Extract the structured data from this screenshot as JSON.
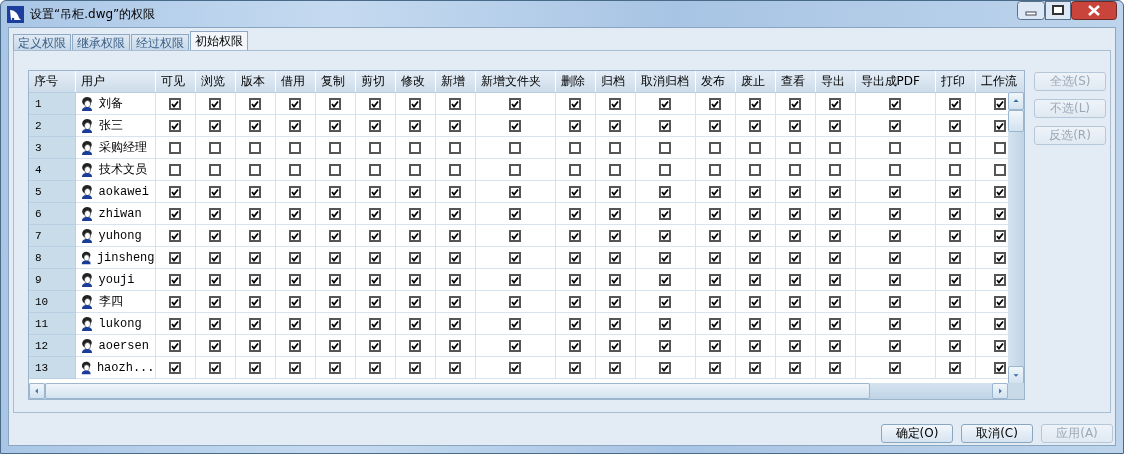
{
  "window": {
    "title": "设置“吊柜.dwg”的权限"
  },
  "tabs": [
    {
      "label": "定义权限",
      "selected": false
    },
    {
      "label": "继承权限",
      "selected": false
    },
    {
      "label": "经过权限",
      "selected": false
    },
    {
      "label": "初始权限",
      "selected": true
    }
  ],
  "table": {
    "columns": [
      "序号",
      "用户",
      "可见",
      "浏览",
      "版本",
      "借用",
      "复制",
      "剪切",
      "修改",
      "新增",
      "新增文件夹",
      "删除",
      "归档",
      "取消归档",
      "发布",
      "废止",
      "查看",
      "导出",
      "导出成PDF",
      "打印",
      "工作流"
    ],
    "rows": [
      {
        "index": "1",
        "user": "刘备",
        "checks": [
          true,
          true,
          true,
          true,
          true,
          true,
          true,
          true,
          true,
          true,
          true,
          true,
          true,
          true,
          true,
          true,
          true,
          true,
          true
        ]
      },
      {
        "index": "2",
        "user": "张三",
        "checks": [
          true,
          true,
          true,
          true,
          true,
          true,
          true,
          true,
          true,
          true,
          true,
          true,
          true,
          true,
          true,
          true,
          true,
          true,
          true
        ]
      },
      {
        "index": "3",
        "user": "采购经理",
        "checks": [
          false,
          false,
          false,
          false,
          false,
          false,
          false,
          false,
          false,
          false,
          false,
          false,
          false,
          false,
          false,
          false,
          false,
          false,
          false
        ]
      },
      {
        "index": "4",
        "user": "技术文员",
        "checks": [
          false,
          false,
          false,
          false,
          false,
          false,
          false,
          false,
          false,
          false,
          false,
          false,
          false,
          false,
          false,
          false,
          false,
          false,
          false
        ]
      },
      {
        "index": "5",
        "user": "aokawei",
        "checks": [
          true,
          true,
          true,
          true,
          true,
          true,
          true,
          true,
          true,
          true,
          true,
          true,
          true,
          true,
          true,
          true,
          true,
          true,
          true
        ]
      },
      {
        "index": "6",
        "user": "zhiwan",
        "checks": [
          true,
          true,
          true,
          true,
          true,
          true,
          true,
          true,
          true,
          true,
          true,
          true,
          true,
          true,
          true,
          true,
          true,
          true,
          true
        ]
      },
      {
        "index": "7",
        "user": "yuhong",
        "checks": [
          true,
          true,
          true,
          true,
          true,
          true,
          true,
          true,
          true,
          true,
          true,
          true,
          true,
          true,
          true,
          true,
          true,
          true,
          true
        ]
      },
      {
        "index": "8",
        "user": "jinsheng",
        "checks": [
          true,
          true,
          true,
          true,
          true,
          true,
          true,
          true,
          true,
          true,
          true,
          true,
          true,
          true,
          true,
          true,
          true,
          true,
          true
        ]
      },
      {
        "index": "9",
        "user": "youji",
        "checks": [
          true,
          true,
          true,
          true,
          true,
          true,
          true,
          true,
          true,
          true,
          true,
          true,
          true,
          true,
          true,
          true,
          true,
          true,
          true
        ]
      },
      {
        "index": "10",
        "user": "李四",
        "checks": [
          true,
          true,
          true,
          true,
          true,
          true,
          true,
          true,
          true,
          true,
          true,
          true,
          true,
          true,
          true,
          true,
          true,
          true,
          true
        ]
      },
      {
        "index": "11",
        "user": "lukong",
        "checks": [
          true,
          true,
          true,
          true,
          true,
          true,
          true,
          true,
          true,
          true,
          true,
          true,
          true,
          true,
          true,
          true,
          true,
          true,
          true
        ]
      },
      {
        "index": "12",
        "user": "aoersen",
        "checks": [
          true,
          true,
          true,
          true,
          true,
          true,
          true,
          true,
          true,
          true,
          true,
          true,
          true,
          true,
          true,
          true,
          true,
          true,
          true
        ]
      },
      {
        "index": "13",
        "user": "haozh...",
        "checks": [
          true,
          true,
          true,
          true,
          true,
          true,
          true,
          true,
          true,
          true,
          true,
          true,
          true,
          true,
          true,
          true,
          true,
          true,
          true
        ]
      }
    ]
  },
  "side_buttons": [
    {
      "label": "全选(S)",
      "disabled": true
    },
    {
      "label": "不选(L)",
      "disabled": true
    },
    {
      "label": "反选(R)",
      "disabled": true
    }
  ],
  "buttons": [
    {
      "label": "确定(O)",
      "disabled": false
    },
    {
      "label": "取消(C)",
      "disabled": false
    },
    {
      "label": "应用(A)",
      "disabled": true
    }
  ]
}
